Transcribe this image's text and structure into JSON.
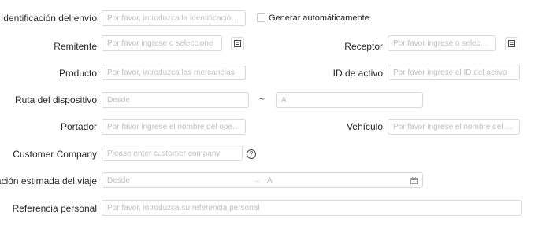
{
  "form": {
    "shipment_id": {
      "label": "Identificación del envío",
      "placeholder": "Por favor, introduzca la identificación d..."
    },
    "auto_generate": {
      "label": "Generar automáticamente",
      "checked": false
    },
    "sender": {
      "label": "Remitente",
      "placeholder": "Por favor ingrese o seleccione",
      "icon": "address-book-icon"
    },
    "receiver": {
      "label": "Receptor",
      "placeholder": "Por favor ingrese o selecc...",
      "icon": "address-book-icon"
    },
    "product": {
      "label": "Producto",
      "placeholder": "Por favor, introduzca las mercancías"
    },
    "asset_id": {
      "label": "ID de activo",
      "placeholder": "Por favor ingrese el ID del activo"
    },
    "device_route": {
      "label": "Ruta del dispositivo",
      "from_placeholder": "Desde",
      "separator": "~",
      "to_placeholder": "A"
    },
    "carrier": {
      "label": "Portador",
      "placeholder": "Por favor ingrese el nombre del operad..."
    },
    "vehicle": {
      "label": "Vehículo",
      "placeholder": "Por favor ingrese el nombre del veh..."
    },
    "customer_company": {
      "label": "Customer Company",
      "placeholder": "Please enter customer company",
      "help_icon": "?"
    },
    "trip_duration": {
      "label": "Duración estimada del viaje",
      "from_placeholder": "Desde",
      "arrow": "→",
      "to_placeholder": "A",
      "icon": "calendar-icon"
    },
    "personal_reference": {
      "label": "Referencia personal",
      "placeholder": "Por favor, introduzca su referencia personal"
    }
  },
  "colors": {
    "border": "#d9d9d9",
    "placeholder": "#bfbfbf",
    "label": "#262626"
  }
}
